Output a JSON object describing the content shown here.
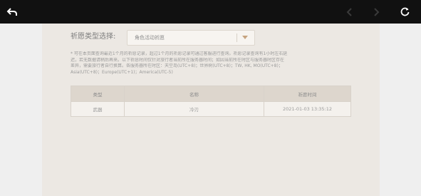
{
  "toolbar": {
    "back_icon": "back-arrow-icon",
    "nav_icons": [
      "nav-arrow-left-icon",
      "nav-arrow-right-icon"
    ],
    "reload_icon": "reload-icon"
  },
  "filter": {
    "label": "祈愿类型选择:",
    "selected": "角色活动祈愿"
  },
  "note": {
    "line1": "* 可在本页面查询最近1个月的祈愿记录，超过1个月的祈愿记录可通过客服进行查询。祈愿记录查询有1小时左右延",
    "line2": "迟，若无数据请稍后再来。以下祈愿时间仅针对旅行者当前所在服务器时间；如因当前所在时区与服务器时区存在",
    "line3": "差异，需要旅行者自行换算。各服务器所在时区：天空岛(UTC+8)；世界树(UTC+8)；TW, HK, MO(UTC+8)；",
    "line4": "Asia(UTC+8)；Europe(UTC+1)；America(UTC-5)"
  },
  "table": {
    "headers": [
      "类型",
      "名称",
      "祈愿时间"
    ],
    "rows": [
      [
        "武器",
        "冷刃",
        "2021-01-03 13:35:12"
      ]
    ]
  },
  "colors": {
    "topbar": "#111111",
    "panel": "#ece8e3",
    "header_bg": "#ddd6cd",
    "accent": "#c6a37e"
  }
}
